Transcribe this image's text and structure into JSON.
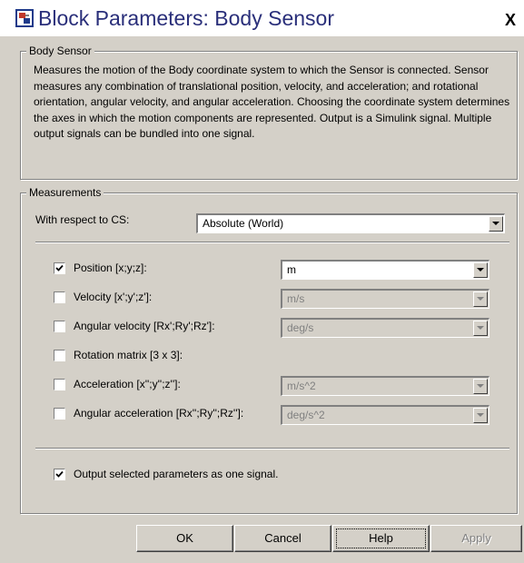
{
  "window": {
    "title": "Block Parameters: Body Sensor",
    "close_label": "X"
  },
  "body_sensor": {
    "legend": "Body Sensor",
    "description": "Measures the motion of the Body coordinate system to which the Sensor is connected. Sensor measures any combination of translational position, velocity, and acceleration; and rotational orientation, angular velocity, and angular acceleration. Choosing the coordinate system determines the axes in which the motion components are represented. Output is a Simulink signal. Multiple output signals can be bundled into one signal."
  },
  "measurements": {
    "legend": "Measurements",
    "cs_label": "With respect to CS:",
    "cs_value": "Absolute (World)",
    "rows": [
      {
        "label": "Position [x;y;z]:",
        "checked": true,
        "unit": "m",
        "enabled": true
      },
      {
        "label": "Velocity [x';y';z']:",
        "checked": false,
        "unit": "m/s",
        "enabled": false
      },
      {
        "label": "Angular velocity [Rx';Ry';Rz']:",
        "checked": false,
        "unit": "deg/s",
        "enabled": false
      },
      {
        "label": "Rotation matrix [3 x 3]:",
        "checked": false,
        "unit": null,
        "enabled": false
      },
      {
        "label": "Acceleration [x'';y'';z'']:",
        "checked": false,
        "unit": "m/s^2",
        "enabled": false
      },
      {
        "label": "Angular acceleration [Rx'';Ry'';Rz'']:",
        "checked": false,
        "unit": "deg/s^2",
        "enabled": false
      }
    ],
    "output_label": "Output selected parameters as one signal.",
    "output_checked": true
  },
  "buttons": {
    "ok": "OK",
    "cancel": "Cancel",
    "help": "Help",
    "apply": "Apply"
  },
  "colors": {
    "dialog_bg": "#d4d0c8",
    "title_text": "#2a2f7a"
  }
}
